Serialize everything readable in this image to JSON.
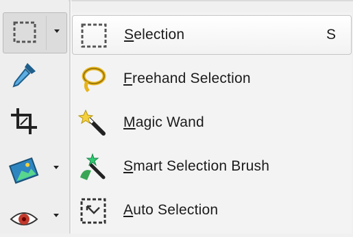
{
  "toolbar": {
    "tools": [
      {
        "icon": "rectangle-selection-icon",
        "has_dropdown": true,
        "active": true
      },
      {
        "icon": "eyedropper-icon",
        "has_dropdown": false
      },
      {
        "icon": "crop-icon",
        "has_dropdown": false
      },
      {
        "icon": "image-adjust-icon",
        "has_dropdown": true
      },
      {
        "icon": "red-eye-icon",
        "has_dropdown": true
      }
    ]
  },
  "menu": {
    "items": [
      {
        "mnemonic": "S",
        "rest": "election",
        "shortcut": "S",
        "icon": "rectangle-selection-icon",
        "selected": true
      },
      {
        "mnemonic": "F",
        "rest": "reehand Selection",
        "shortcut": "",
        "icon": "lasso-icon"
      },
      {
        "mnemonic": "M",
        "rest": "agic Wand",
        "shortcut": "",
        "icon": "magic-wand-icon"
      },
      {
        "mnemonic": "S",
        "rest": "mart Selection Brush",
        "shortcut": "",
        "icon": "smart-brush-icon"
      },
      {
        "mnemonic": "A",
        "rest": "uto Selection",
        "shortcut": "",
        "icon": "auto-selection-icon"
      }
    ]
  },
  "colors": {
    "accent_yellow": "#e8b41c",
    "eyedropper_blue": "#2e86c1",
    "eye_red": "#c0392b",
    "green": "#3aa655"
  }
}
